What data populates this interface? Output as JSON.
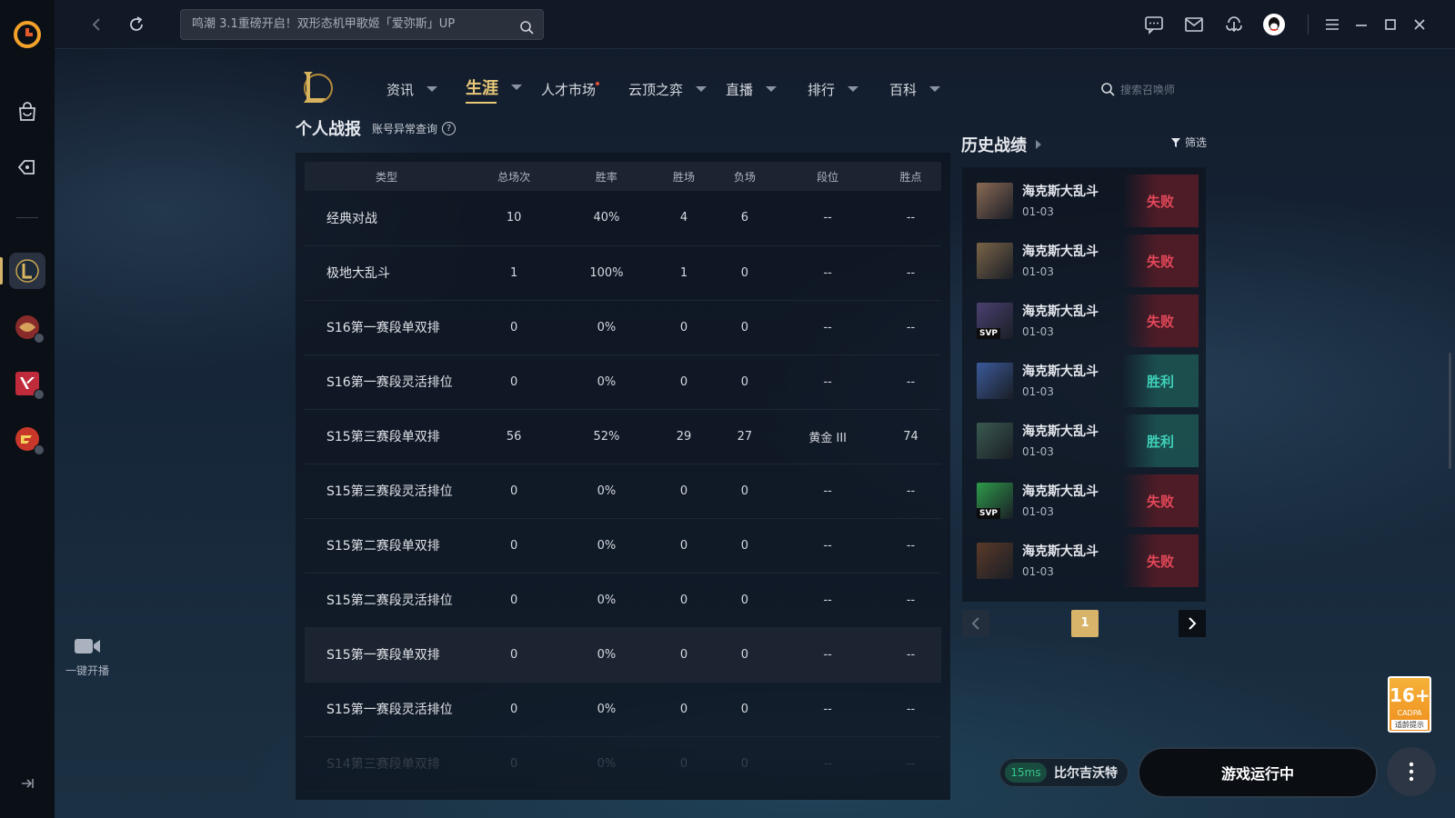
{
  "topbar": {
    "search_text": "鸣潮 3.1重磅开启！双形态机甲歌姬「爱弥斯」UP"
  },
  "sidebar": {
    "live_label": "一键开播"
  },
  "game_nav": {
    "items": [
      {
        "label": "资讯"
      },
      {
        "label": "生涯"
      },
      {
        "label": "人才市场"
      },
      {
        "label": "云顶之弈"
      },
      {
        "label": "直播"
      },
      {
        "label": "排行"
      },
      {
        "label": "百科"
      }
    ],
    "active": "生涯",
    "summoner_search_placeholder": "搜索召唤师"
  },
  "stats": {
    "title": "个人战报",
    "anomaly_link": "账号异常查询",
    "help_glyph": "?",
    "headers": [
      "类型",
      "总场次",
      "胜率",
      "胜场",
      "负场",
      "段位",
      "胜点"
    ],
    "rows": [
      [
        "经典对战",
        "10",
        "40%",
        "4",
        "6",
        "--",
        "--"
      ],
      [
        "极地大乱斗",
        "1",
        "100%",
        "1",
        "0",
        "--",
        "--"
      ],
      [
        "S16第一赛段单双排",
        "0",
        "0%",
        "0",
        "0",
        "--",
        "--"
      ],
      [
        "S16第一赛段灵活排位",
        "0",
        "0%",
        "0",
        "0",
        "--",
        "--"
      ],
      [
        "S15第三赛段单双排",
        "56",
        "52%",
        "29",
        "27",
        "黄金 III",
        "74"
      ],
      [
        "S15第三赛段灵活排位",
        "0",
        "0%",
        "0",
        "0",
        "--",
        "--"
      ],
      [
        "S15第二赛段单双排",
        "0",
        "0%",
        "0",
        "0",
        "--",
        "--"
      ],
      [
        "S15第二赛段灵活排位",
        "0",
        "0%",
        "0",
        "0",
        "--",
        "--"
      ],
      [
        "S15第一赛段单双排",
        "0",
        "0%",
        "0",
        "0",
        "--",
        "--"
      ],
      [
        "S15第一赛段灵活排位",
        "0",
        "0%",
        "0",
        "0",
        "--",
        "--"
      ],
      [
        "S14第三赛段单双排",
        "0",
        "0%",
        "0",
        "0",
        "--",
        "--"
      ]
    ]
  },
  "history": {
    "title": "历史战绩",
    "filter_label": "筛选",
    "matches": [
      {
        "mode": "海克斯大乱斗",
        "date": "01-03",
        "result": "失败",
        "outcome": "loss",
        "svp": false,
        "champ_color": "#8a6a55"
      },
      {
        "mode": "海克斯大乱斗",
        "date": "01-03",
        "result": "失败",
        "outcome": "loss",
        "svp": false,
        "champ_color": "#7a6448"
      },
      {
        "mode": "海克斯大乱斗",
        "date": "01-03",
        "result": "失败",
        "outcome": "loss",
        "svp": true,
        "svp_label": "SVP",
        "champ_color": "#4a4070"
      },
      {
        "mode": "海克斯大乱斗",
        "date": "01-03",
        "result": "胜利",
        "outcome": "win",
        "svp": false,
        "champ_color": "#3b5a9a"
      },
      {
        "mode": "海克斯大乱斗",
        "date": "01-03",
        "result": "胜利",
        "outcome": "win",
        "svp": false,
        "champ_color": "#3a5a50"
      },
      {
        "mode": "海克斯大乱斗",
        "date": "01-03",
        "result": "失败",
        "outcome": "loss",
        "svp": true,
        "svp_label": "SVP",
        "champ_color": "#2e9a4a"
      },
      {
        "mode": "海克斯大乱斗",
        "date": "01-03",
        "result": "失败",
        "outcome": "loss",
        "svp": false,
        "champ_color": "#5a3a28"
      }
    ],
    "current_page": "1"
  },
  "age_rating": {
    "number": "16+",
    "org": "CADPA",
    "caption": "适龄提示"
  },
  "footer": {
    "ping": "15ms",
    "server": "比尔吉沃特",
    "play_label": "游戏运行中"
  },
  "colors": {
    "accent_gold": "#e8c878",
    "loss_red": "#e5485a",
    "win_teal": "#3fd0b8"
  }
}
